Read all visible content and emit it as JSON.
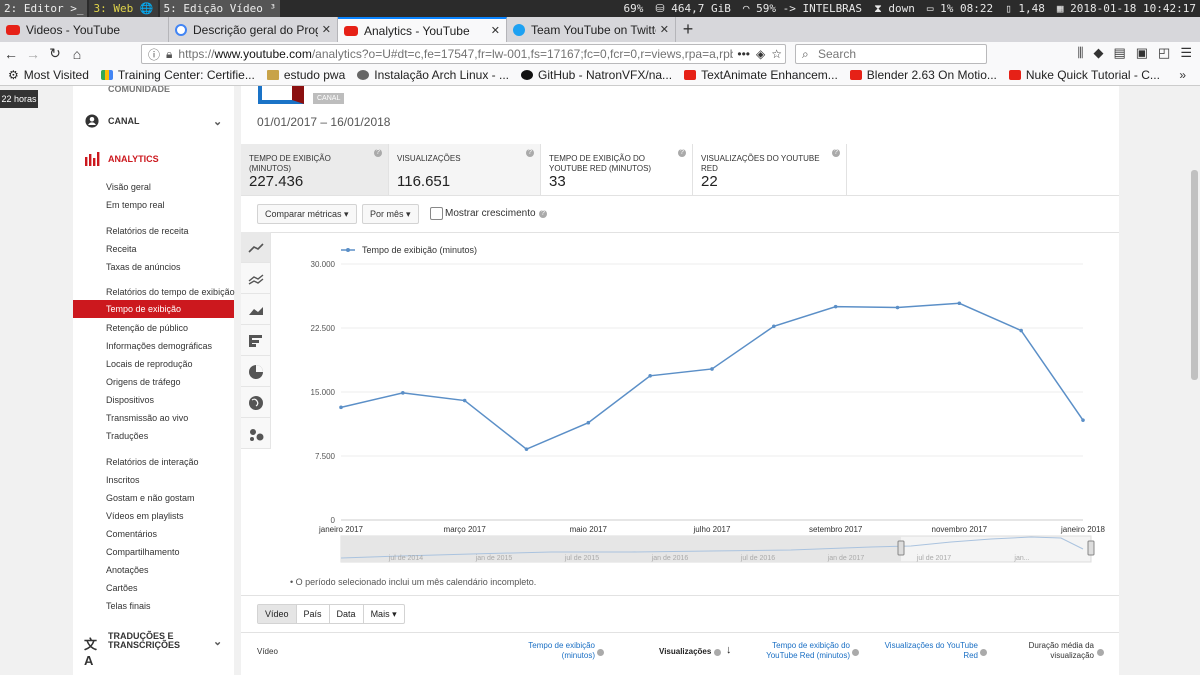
{
  "system_bar": {
    "workspaces": [
      "2: Editor >_",
      "3: Web 🌐",
      "5: Edição Vídeo ³"
    ],
    "active_workspace": 1,
    "cpu": "69%",
    "disk": "464,7 GiB",
    "wifi": "59% -> INTELBRAS",
    "network": "down",
    "battery": "1% 08:22",
    "load": "1,48",
    "datetime": "2018-01-18 10:42:17"
  },
  "tabs": [
    {
      "label": "Videos - YouTube",
      "icon": "youtube-icon",
      "active": false
    },
    {
      "label": "Descrição geral do Progra",
      "icon": "google-icon",
      "active": false
    },
    {
      "label": "Analytics - YouTube",
      "icon": "youtube-icon",
      "active": true
    },
    {
      "label": "Team YouTube on Twitte",
      "icon": "twitter-icon",
      "active": false
    }
  ],
  "url": {
    "prefix": "https://",
    "host": "www.youtube.com",
    "path": "/analytics?o=U#dt=c,fe=17547,fr=lw-001,fs=17167;fc=0,fcr=0,r=views,rpa=a,rpbr"
  },
  "search_placeholder": "Search",
  "bookmarks": [
    {
      "label": "Most Visited",
      "icon": "gear-icon"
    },
    {
      "label": "Training Center: Certifie...",
      "icon": "training-icon"
    },
    {
      "label": "estudo pwa",
      "icon": "folder-icon"
    },
    {
      "label": "Instalação Arch Linux - ...",
      "icon": "arch-icon"
    },
    {
      "label": "GitHub - NatronVFX/na...",
      "icon": "github-icon"
    },
    {
      "label": "TextAnimate Enhancem...",
      "icon": "youtube-icon"
    },
    {
      "label": "Blender 2.63 On Motio...",
      "icon": "youtube-icon"
    },
    {
      "label": "Nuke Quick Tutorial - C...",
      "icon": "youtube-icon"
    }
  ],
  "tooltip": "22 horas",
  "sidebar": {
    "top_cut": "COMUNIDADE",
    "canal": "CANAL",
    "analytics": "ANALYTICS",
    "items": [
      "Visão geral",
      "Em tempo real",
      "Relatórios de receita",
      "Receita",
      "Taxas de anúncios",
      "Relatórios do tempo de exibição",
      "Tempo de exibição",
      "Retenção de público",
      "Informações demográficas",
      "Locais de reprodução",
      "Origens de tráfego",
      "Dispositivos",
      "Transmissão ao vivo",
      "Traduções",
      "Relatórios de interação",
      "Inscritos",
      "Gostam e não gostam",
      "Vídeos em playlists",
      "Comentários",
      "Compartilhamento",
      "Anotações",
      "Cartões",
      "Telas finais"
    ],
    "active_item": "Tempo de exibição",
    "traducoes_section": "TRADUÇÕES E TRANSCRIÇÕES"
  },
  "header": {
    "badge": "CANAL",
    "date_range": "01/01/2017 – 16/01/2018"
  },
  "metrics": [
    {
      "label": "TEMPO DE EXIBIÇÃO (MINUTOS)",
      "value": "227.436"
    },
    {
      "label": "VISUALIZAÇÕES",
      "value": "116.651"
    },
    {
      "label": "TEMPO DE EXIBIÇÃO DO YOUTUBE RED (MINUTOS)",
      "value": "33"
    },
    {
      "label": "VISUALIZAÇÕES DO YOUTUBE RED",
      "value": "22"
    }
  ],
  "controls": {
    "compare": "Comparar métricas",
    "period": "Por mês",
    "growth": "Mostrar crescimento"
  },
  "chart_data": {
    "type": "line",
    "series": [
      {
        "name": "Tempo de exibição (minutos)",
        "color": "#5b8fc7",
        "values": [
          13200,
          14900,
          14000,
          8300,
          11400,
          16900,
          17700,
          22700,
          25000,
          24900,
          25400,
          22200,
          11700
        ]
      }
    ],
    "y_ticks": [
      "30.000",
      "22.500",
      "15.000",
      "7.500",
      "0"
    ],
    "x_tick_labels": [
      "janeiro 2017",
      "março 2017",
      "maio 2017",
      "julho 2017",
      "setembro 2017",
      "novembro 2017",
      "janeiro 2018"
    ],
    "ylim": [
      0,
      30000
    ],
    "overview_labels": [
      "jul de 2014",
      "jan de 2015",
      "jul de 2015",
      "jan de 2016",
      "jul de 2016",
      "jan de 2017",
      "jul de 2017",
      "jan..."
    ],
    "grid": true,
    "legend": "top-left"
  },
  "footnote": "• O período selecionado inclui um mês calendário incompleto.",
  "table_tabs": [
    "Vídeo",
    "País",
    "Data",
    "Mais"
  ],
  "table_headers": [
    "Vídeo",
    "Tempo de exibição (minutos)",
    "Visualizações",
    "Tempo de exibição do YouTube Red (minutos)",
    "Visualizações do YouTube Red",
    "Duração média da visualização"
  ]
}
